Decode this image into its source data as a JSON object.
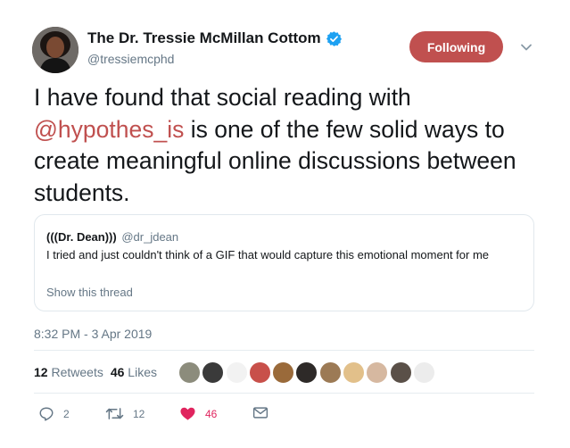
{
  "author": {
    "name": "The Dr. Tressie McMillan Cottom",
    "handle": "@tressiemcphd",
    "verified_icon": "verified-badge-icon"
  },
  "follow_button": {
    "label": "Following",
    "color": "#c0504f"
  },
  "menu_icon": "chevron-down-icon",
  "tweet": {
    "text_before": "I have found that social reading with ",
    "mention": "@hypothes_is",
    "text_after": " is one of the few solid ways to create meaningful online discussions between students.",
    "mention_color": "#c0504f"
  },
  "quoted_tweet": {
    "name": "(((Dr. Dean)))",
    "handle": "@dr_jdean",
    "text": "I tried and just couldn't think of a GIF that would capture this emotional moment for me",
    "show_thread": "Show this thread"
  },
  "timestamp": "8:32 PM - 3 Apr 2019",
  "stats": {
    "retweets_count": "12",
    "retweets_label": "Retweets",
    "likes_count": "46",
    "likes_label": "Likes"
  },
  "likers": [
    {
      "color": "#8c8c7c"
    },
    {
      "color": "#3a3a3a"
    },
    {
      "color": "#f2f2f2"
    },
    {
      "color": "#c8504a"
    },
    {
      "color": "#9a6a3a"
    },
    {
      "color": "#2e2a28"
    },
    {
      "color": "#9c7a55"
    },
    {
      "color": "#e2c08a"
    },
    {
      "color": "#d6b8a0"
    },
    {
      "color": "#5a5048"
    },
    {
      "color": "#ececec"
    }
  ],
  "actions": {
    "reply": {
      "icon": "reply-icon",
      "count": "2"
    },
    "retweet": {
      "icon": "retweet-icon",
      "count": "12"
    },
    "like": {
      "icon": "heart-icon",
      "count": "46",
      "color": "#e0245e"
    },
    "dm": {
      "icon": "envelope-icon"
    }
  }
}
